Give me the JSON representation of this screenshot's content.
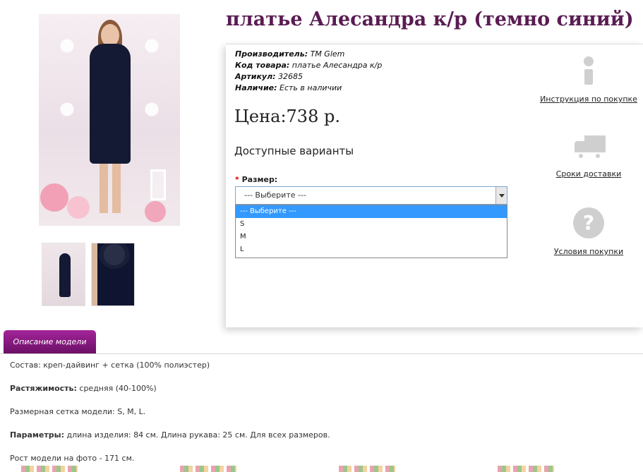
{
  "product": {
    "title": "платье Алесандра к/р (темно синий)",
    "manufacturer_label": "Производитель:",
    "manufacturer_value": "TM Glem",
    "code_label": "Код товара:",
    "code_value": "платье Алесандра к/р",
    "sku_label": "Артикул:",
    "sku_value": "32685",
    "stock_label": "Наличие:",
    "stock_value": "Есть в наличии",
    "price": "Цена:738 р.",
    "variants_heading": "Доступные варианты"
  },
  "size": {
    "required_mark": "*",
    "label": "Размер:",
    "selected": "--- Выберите ---",
    "options": [
      "--- Выберите ---",
      "S",
      "M",
      "L"
    ]
  },
  "side_links": {
    "instructions": "Инструкция по покупке",
    "delivery": "Сроки доставки",
    "terms": "Условия покупки",
    "question_glyph": "?"
  },
  "icons": {
    "info": "info-icon",
    "delivery": "truck-icon",
    "terms": "question-icon"
  },
  "description": {
    "tab_label": "Описание модели",
    "composition": "Состав: креп-дайвинг + сетка (100% полиэстер)",
    "stretch_label": "Растяжимость:",
    "stretch_value": " средняя (40-100%)",
    "sizes": "Размерная сетка модели: S, M, L.",
    "params_label": "Параметры:",
    "params_value": " длина изделия: 84 см. Длина рукава: 25 см. Для всех размеров.",
    "height": "Рост модели на фото - 171 см."
  },
  "colors": {
    "title": "#5a1c52",
    "tab": "#8b1a86",
    "selected_option": "#3399ff"
  }
}
